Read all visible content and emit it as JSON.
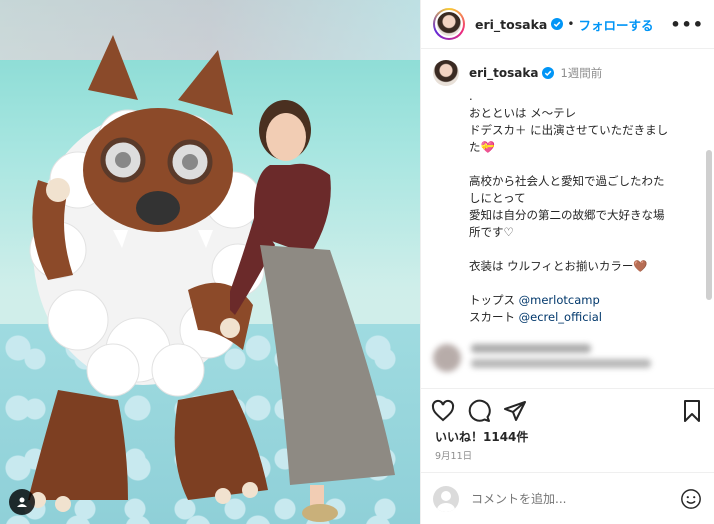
{
  "post": {
    "username": "eri_tosaka",
    "separator": "•",
    "follow_label": "フォローする",
    "more_label": "•••",
    "caption_username": "eri_tosaka",
    "caption_time": "1週間前",
    "caption": {
      "l1": ".",
      "l2": "おとといは メ〜テレ",
      "l3": "ドデスカ＋ に出演させていただきまし",
      "l4": "た💝",
      "l5": "高校から社会人と愛知で過ごしたわた",
      "l6": "しにとって",
      "l7": "愛知は自分の第二の故郷で大好きな場",
      "l8": "所です♡",
      "l9": "衣装は ウルフィとお揃いカラー🤎",
      "l10_prefix": "トップス ",
      "l10_link": "@merlotcamp",
      "l11_prefix": "スカート ",
      "l11_link": "@ecrel_official"
    },
    "likes": "いいね！1144件",
    "date": "9月11日",
    "comment_placeholder": "コメントを追加...",
    "colors": {
      "link": "#00376b",
      "follow": "#0095f6",
      "verified": "#0095f6"
    },
    "icons": [
      "heart-icon",
      "comment-icon",
      "share-icon",
      "save-icon",
      "emoji-icon",
      "verified-icon",
      "user-tag-icon"
    ]
  }
}
